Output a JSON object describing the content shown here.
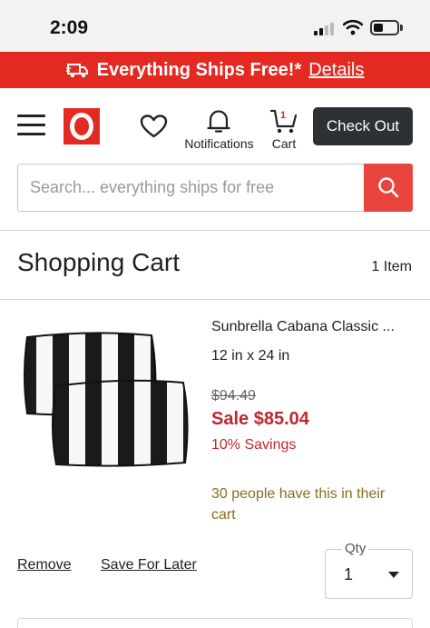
{
  "status_bar": {
    "time": "2:09",
    "icons": [
      "signal-icon",
      "wifi-icon",
      "battery-icon"
    ]
  },
  "promo": {
    "icon": "truck-icon",
    "text": "Everything Ships Free!*",
    "link": "Details",
    "color": "#e32a22"
  },
  "header": {
    "icons": [
      "menu-icon",
      "logo-icon",
      "heart-icon",
      "bell-icon",
      "cart-icon"
    ],
    "notifications_label": "Notifications",
    "cart_count": "1",
    "cart_label": "Cart",
    "checkout_label": "Check Out"
  },
  "search": {
    "placeholder": "Search... everything ships for free",
    "icon": "search-icon"
  },
  "cart": {
    "title": "Shopping Cart",
    "item_count": "1 Item"
  },
  "item": {
    "name": "Sunbrella Cabana Classic ...",
    "size": "12 in x 24 in",
    "original_price": "$94.49",
    "sale_price": "Sale $85.04",
    "savings": "10% Savings",
    "popularity": "30 people have this in their cart",
    "remove_label": "Remove",
    "save_label": "Save For Later",
    "qty_label": "Qty",
    "qty_value": "1"
  },
  "colors": {
    "brand_red": "#e32a22",
    "sale_red": "#c2272d",
    "popularity_gold": "#8a6d1c",
    "dark_button": "#2d3035"
  }
}
